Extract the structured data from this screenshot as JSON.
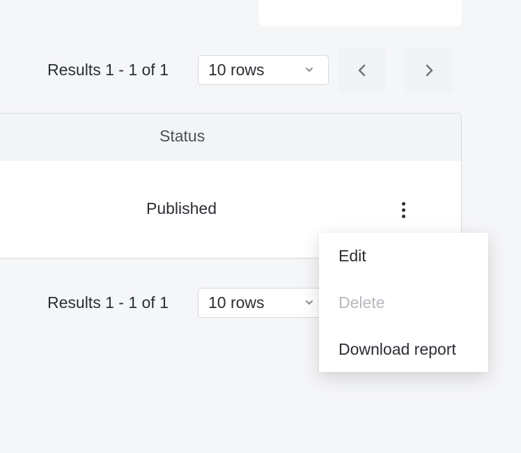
{
  "pagination_top": {
    "results_text": "Results 1 - 1 of 1",
    "rows_value": "10 rows"
  },
  "table": {
    "columns": [
      "Status"
    ],
    "rows": [
      {
        "status": "Published"
      }
    ]
  },
  "pagination_bottom": {
    "results_text": "Results 1 - 1 of 1",
    "rows_value": "10 rows"
  },
  "row_menu": {
    "items": [
      {
        "label": "Edit",
        "disabled": false
      },
      {
        "label": "Delete",
        "disabled": true
      },
      {
        "label": "Download report",
        "disabled": false
      }
    ]
  },
  "icons": {
    "prev": "chevron-left-icon",
    "next": "chevron-right-icon",
    "select": "chevron-down-icon",
    "row_actions": "more-vertical-icon"
  }
}
